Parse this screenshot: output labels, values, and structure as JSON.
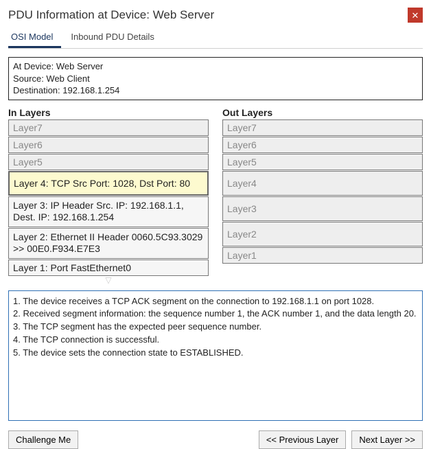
{
  "window": {
    "title": "PDU Information at Device: Web Server",
    "close_glyph": "✕"
  },
  "tabs": {
    "osi": "OSI Model",
    "inbound": "Inbound PDU Details"
  },
  "info": {
    "line1": "At Device: Web Server",
    "line2": "Source: Web Client",
    "line3": "Destination: 192.168.1.254"
  },
  "headers": {
    "in": "In Layers",
    "out": "Out Layers"
  },
  "in_layers": {
    "l7": "Layer7",
    "l6": "Layer6",
    "l5": "Layer5",
    "l4": "Layer 4: TCP Src Port: 1028, Dst Port: 80",
    "l3": "Layer 3: IP Header Src. IP: 192.168.1.1, Dest. IP: 192.168.1.254",
    "l2": "Layer 2: Ethernet II Header 0060.5C93.3029 >> 00E0.F934.E7E3",
    "l1": "Layer 1: Port FastEthernet0"
  },
  "out_layers": {
    "l7": "Layer7",
    "l6": "Layer6",
    "l5": "Layer5",
    "l4": "Layer4",
    "l3": "Layer3",
    "l2": "Layer2",
    "l1": "Layer1"
  },
  "notes": "1. The device receives a TCP ACK segment on the connection to 192.168.1.1 on port 1028.\n2. Received segment information: the sequence number 1, the ACK number 1, and the data length 20.\n3. The TCP segment has the expected peer sequence number.\n4. The TCP connection is successful.\n5. The device sets the connection state to ESTABLISHED.",
  "buttons": {
    "challenge": "Challenge Me",
    "prev": "<< Previous Layer",
    "next": "Next Layer >>"
  }
}
